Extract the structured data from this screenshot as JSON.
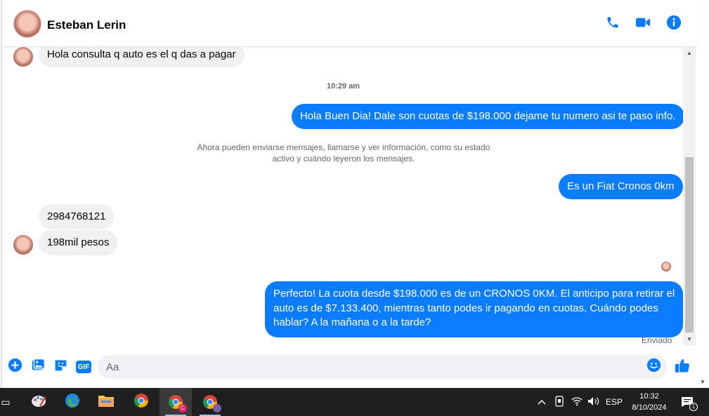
{
  "header": {
    "contact_name": "Esteban Lerin",
    "icons": [
      "phone-icon",
      "video-icon",
      "info-icon"
    ],
    "accent_color": "#0a7cff"
  },
  "thread": {
    "msg_incoming_1": "Hola consulta q auto es el q das a pagar",
    "timestamp_1": "10:29 am",
    "msg_outgoing_1": "Hola Buen Dia! Dale son cuotas de $198.000 dejame tu numero asi te paso info.",
    "system_notice_line1": "Ahora pueden enviarse mensajes, llamarse y ver información, como su estado",
    "system_notice_line2": "activo y cuándo leyeron los mensajes.",
    "msg_outgoing_2": "Es un Fiat Cronos 0km",
    "msg_incoming_2": "2984768121",
    "msg_incoming_3": "198mil pesos",
    "msg_outgoing_3_line1": "Perfecto! La cuota desde $198.000 es de un CRONOS 0KM. El anticipo para retirar el",
    "msg_outgoing_3_line2": "auto es de $7.133.400, mientras tanto podes ir pagando en cuotas. Cuándo podes",
    "msg_outgoing_3_line3": "hablar? A la mañana o a la tarde?",
    "status_sent": "Enviado"
  },
  "composer": {
    "placeholder": "Aa",
    "icons": [
      "plus-icon",
      "image-icon",
      "sticker-icon",
      "gif-icon",
      "emoji-icon",
      "like-icon"
    ],
    "gif_label": "GIF"
  },
  "taskbar": {
    "apps": [
      "task-view-icon",
      "paint-icon",
      "edge-icon",
      "file-explorer-icon",
      "chrome-icon",
      "chrome-profile-c-icon",
      "chrome-profile-2-icon"
    ],
    "profile_c_badge": "C",
    "language": "ESP",
    "time": "10:32",
    "date": "8/10/2024",
    "notification_count": "1"
  }
}
